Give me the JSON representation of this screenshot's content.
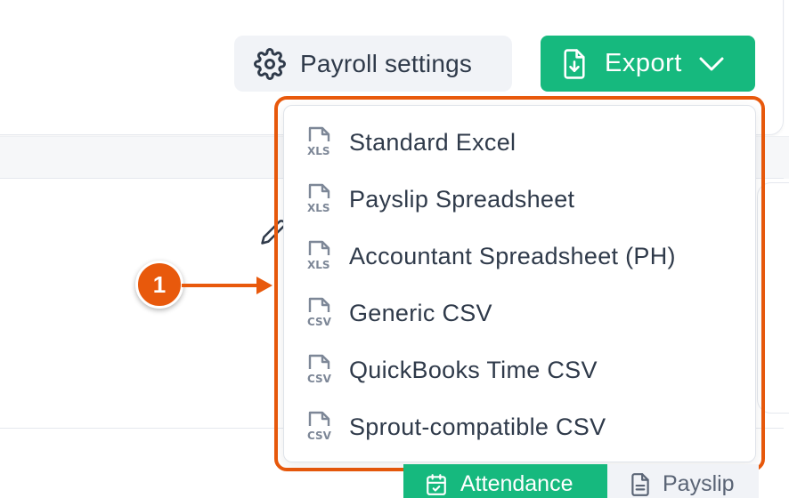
{
  "toolbar": {
    "settings_label": "Payroll settings",
    "export_label": "Export"
  },
  "export_menu": {
    "items": [
      {
        "label": "Standard Excel",
        "file_type": "XLS"
      },
      {
        "label": "Payslip Spreadsheet",
        "file_type": "XLS"
      },
      {
        "label": "Accountant Spreadsheet (PH)",
        "file_type": "XLS"
      },
      {
        "label": "Generic CSV",
        "file_type": "CSV"
      },
      {
        "label": "QuickBooks Time CSV",
        "file_type": "CSV"
      },
      {
        "label": "Sprout-compatible CSV",
        "file_type": "CSV"
      }
    ]
  },
  "callout": {
    "number": "1"
  },
  "tabs": {
    "attendance_label": "Attendance",
    "payslip_label": "Payslip"
  },
  "colors": {
    "accent_green": "#16b97e",
    "callout_orange": "#e8590c",
    "text_dark": "#2f3a4a",
    "icon_gray": "#7d8797"
  },
  "icons": {
    "settings": "gear-icon",
    "export": "file-download-icon",
    "export_caret": "chevron-down-icon",
    "xls": "xls-file-icon",
    "csv": "csv-file-icon",
    "edit": "pencil-icon",
    "attendance": "calendar-check-icon",
    "payslip": "document-icon"
  }
}
